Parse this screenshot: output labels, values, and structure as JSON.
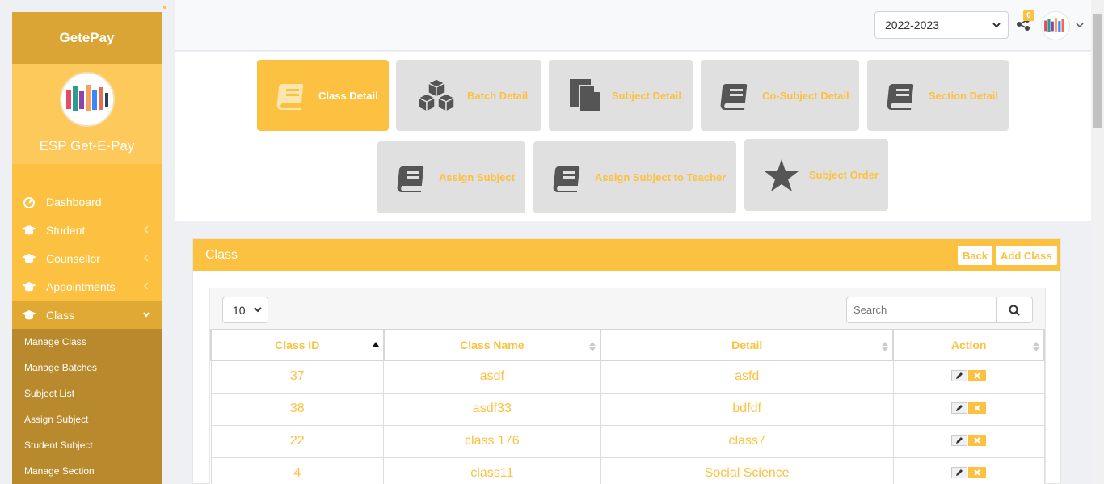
{
  "sidebar": {
    "brand": "GetePay",
    "school_name": "ESP Get-E-Pay",
    "menu": [
      {
        "label": "Dashboard"
      },
      {
        "label": "Student"
      },
      {
        "label": "Counsellor"
      },
      {
        "label": "Appointments"
      },
      {
        "label": "Class"
      }
    ],
    "submenu": [
      {
        "label": "Manage Class"
      },
      {
        "label": "Manage Batches"
      },
      {
        "label": "Subject List"
      },
      {
        "label": "Assign Subject"
      },
      {
        "label": "Student Subject"
      },
      {
        "label": "Manage Section"
      }
    ]
  },
  "header": {
    "year": "2022-2023",
    "notification_count": "0"
  },
  "tiles": [
    {
      "label": "Class Detail",
      "icon": "book-icon",
      "active": true
    },
    {
      "label": "Batch Detail",
      "icon": "cubes-icon"
    },
    {
      "label": "Subject Detail",
      "icon": "copy-icon"
    },
    {
      "label": "Co-Subject Detail",
      "icon": "book-icon"
    },
    {
      "label": "Section Detail",
      "icon": "book-icon"
    },
    {
      "label": "Assign Subject",
      "icon": "book-icon"
    },
    {
      "label": "Assign Subject to Teacher",
      "icon": "book-icon"
    },
    {
      "label": "Subject Order",
      "icon": "star-icon"
    }
  ],
  "panel": {
    "title": "Class",
    "back_label": "Back",
    "add_label": "Add Class",
    "page_length": "10",
    "search_placeholder": "Search",
    "columns": [
      "Class ID",
      "Class Name",
      "Detail",
      "Action"
    ],
    "rows": [
      {
        "id": "37",
        "name": "asdf",
        "detail": "asfd"
      },
      {
        "id": "38",
        "name": "asdf33",
        "detail": "bdfdf"
      },
      {
        "id": "22",
        "name": "class 176",
        "detail": "class7"
      },
      {
        "id": "4",
        "name": "class11",
        "detail": "Social Science"
      }
    ]
  },
  "colors": {
    "accent": "#fcc140",
    "sidebar_dark": "#dba535",
    "submenu_bg": "#b88a2d",
    "tile_bg": "#e0e0e0"
  }
}
